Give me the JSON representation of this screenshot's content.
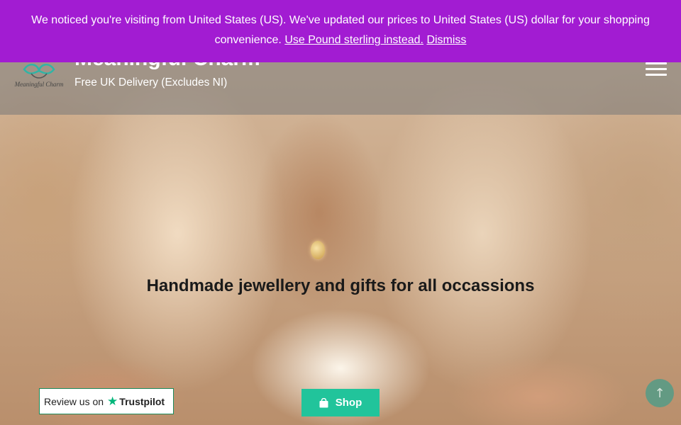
{
  "notice": {
    "message": "We noticed you're visiting from United States (US). We've updated our prices to United States (US) dollar for your shopping convenience.",
    "switch_link": "Use Pound sterling instead.",
    "dismiss_link": "Dismiss",
    "background_color": "#a21cd2"
  },
  "header": {
    "site_name": "Meaningful Charm",
    "tagline": "Free UK Delivery (Excludes NI)",
    "logo_icon": "meaningful-charm-logo",
    "menu_icon": "hamburger-menu-icon"
  },
  "hero": {
    "headline": "Handmade jewellery and gifts for all occassions",
    "shop_button": "Shop",
    "shop_icon": "shopping-bag-icon",
    "shop_button_color": "#21c49b"
  },
  "trustpilot": {
    "prefix": "Review us on",
    "brand": "Trustpilot",
    "icon": "trustpilot-star-icon",
    "brand_color": "#00b67a"
  },
  "scroll_top": {
    "icon": "arrow-up-icon",
    "glyph": "↑"
  }
}
